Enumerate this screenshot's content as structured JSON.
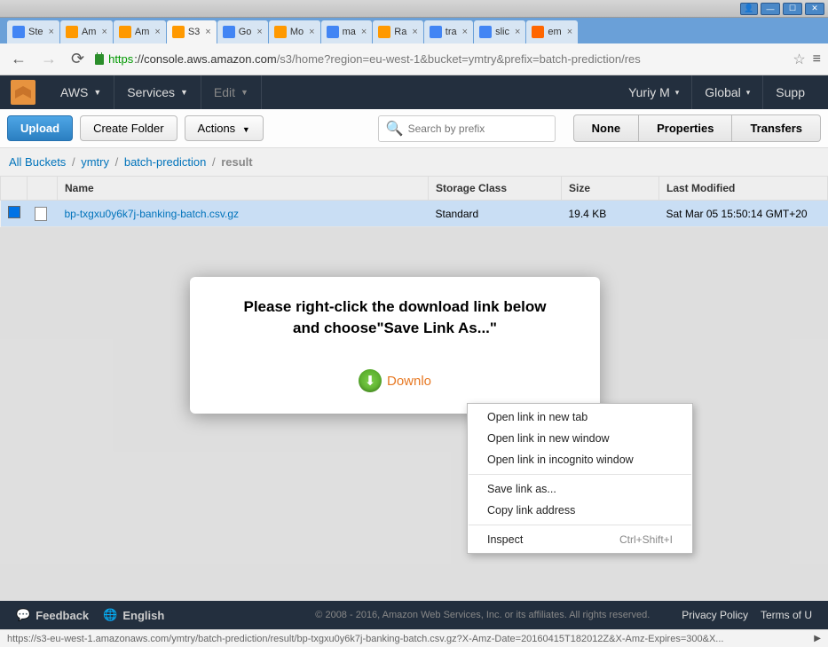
{
  "window": {
    "tabs": [
      {
        "label": "Ste",
        "color": "#4285f4"
      },
      {
        "label": "Am",
        "color": "#ff9900"
      },
      {
        "label": "Am",
        "color": "#ff9900"
      },
      {
        "label": "S3",
        "color": "#ff9900",
        "active": true
      },
      {
        "label": "Go",
        "color": "#4285f4"
      },
      {
        "label": "Mo",
        "color": "#ff9900"
      },
      {
        "label": "ma",
        "color": "#4285f4"
      },
      {
        "label": "Ra",
        "color": "#ff9900"
      },
      {
        "label": "tra",
        "color": "#4285f4"
      },
      {
        "label": "slic",
        "color": "#4285f4"
      },
      {
        "label": "em",
        "color": "#ff6600"
      }
    ]
  },
  "url": {
    "scheme": "https",
    "host": "://console.aws.amazon.com",
    "path": "/s3/home?region=eu-west-1&bucket=ymtry&prefix=batch-prediction/res"
  },
  "aws_nav": {
    "brand": "AWS",
    "services": "Services",
    "edit": "Edit",
    "user": "Yuriy M",
    "region": "Global",
    "support": "Supp"
  },
  "toolbar": {
    "upload": "Upload",
    "create_folder": "Create Folder",
    "actions": "Actions",
    "search_placeholder": "Search by prefix",
    "tabs": {
      "none": "None",
      "properties": "Properties",
      "transfers": "Transfers"
    }
  },
  "breadcrumb": {
    "root": "All Buckets",
    "bucket": "ymtry",
    "folder": "batch-prediction",
    "current": "result"
  },
  "table": {
    "headers": {
      "name": "Name",
      "storage": "Storage Class",
      "size": "Size",
      "modified": "Last Modified"
    },
    "rows": [
      {
        "name": "bp-txgxu0y6k7j-banking-batch.csv.gz",
        "storage": "Standard",
        "size": "19.4 KB",
        "modified": "Sat Mar 05 15:50:14 GMT+20"
      }
    ]
  },
  "modal": {
    "line1": "Please right-click the download link below",
    "line2": "and choose\"Save Link As...\"",
    "download": "Downlo"
  },
  "context_menu": {
    "items1": [
      "Open link in new tab",
      "Open link in new window",
      "Open link in incognito window"
    ],
    "items2": [
      "Save link as...",
      "Copy link address"
    ],
    "inspect": "Inspect",
    "inspect_shortcut": "Ctrl+Shift+I"
  },
  "footer": {
    "feedback": "Feedback",
    "english": "English",
    "copyright": "© 2008 - 2016, Amazon Web Services, Inc. or its affiliates. All rights reserved.",
    "privacy": "Privacy Policy",
    "terms": "Terms of U"
  },
  "status_bar": "https://s3-eu-west-1.amazonaws.com/ymtry/batch-prediction/result/bp-txgxu0y6k7j-banking-batch.csv.gz?X-Amz-Date=20160415T182012Z&X-Amz-Expires=300&X..."
}
